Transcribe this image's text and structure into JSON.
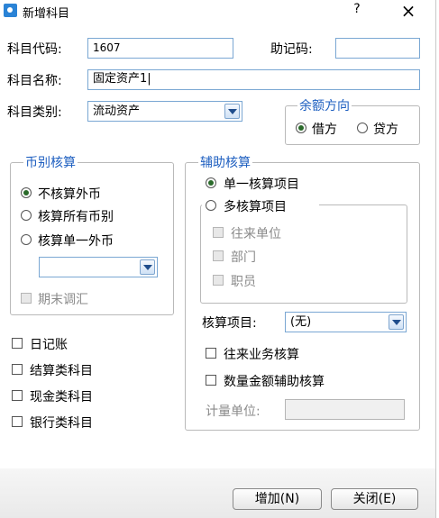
{
  "window": {
    "title": "新增科目",
    "help": "?",
    "close": "×"
  },
  "form": {
    "code_label": "科目代码:",
    "code_value": "1607",
    "mnemonic_label": "助记码:",
    "mnemonic_value": "",
    "name_label": "科目名称:",
    "name_value": "固定资产1|",
    "type_label": "科目类别:",
    "type_value": "流动资产"
  },
  "balance": {
    "legend": "余额方向",
    "debit": "借方",
    "credit": "贷方",
    "selected": "debit"
  },
  "currency": {
    "legend": "币别核算",
    "opt_none": "不核算外币",
    "opt_all": "核算所有币别",
    "opt_single": "核算单一外币",
    "single_select": "",
    "period_end": "期末调汇"
  },
  "aux": {
    "legend": "辅助核算",
    "single": "单一核算项目",
    "multi": "多核算项目",
    "items": [
      "往来单位",
      "部门",
      "职员"
    ],
    "item_label": "核算项目:",
    "item_value": "(无)",
    "contact_check": "往来业务核算",
    "quantity_check": "数量金额辅助核算",
    "unit_label": "计量单位:"
  },
  "flags": {
    "journal": "日记账",
    "settlement": "结算类科目",
    "cash": "现金类科目",
    "bank": "银行类科目"
  },
  "buttons": {
    "add": "增加(N)",
    "close": "关闭(E)"
  },
  "colors": {
    "accent": "#1e5fc0",
    "border": "#7aa7d3"
  }
}
